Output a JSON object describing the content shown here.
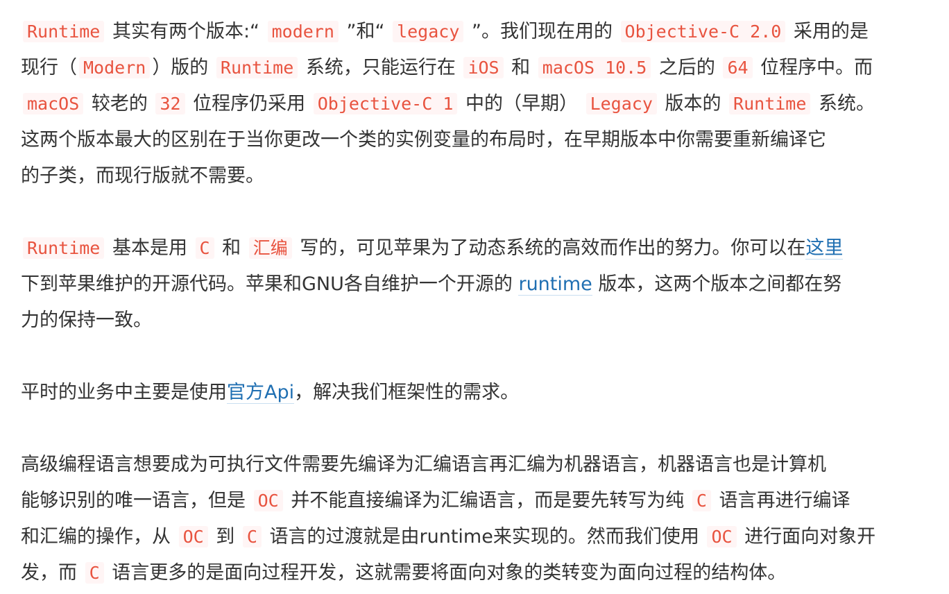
{
  "paragraphs": [
    {
      "lines": [
        [
          {
            "type": "code",
            "text": "Runtime"
          },
          {
            "type": "text",
            "text": " 其实有两个版本:“ "
          },
          {
            "type": "code",
            "text": "modern"
          },
          {
            "type": "text",
            "text": " ”和“ "
          },
          {
            "type": "code",
            "text": "legacy"
          },
          {
            "type": "text",
            "text": " ”。我们现在用的 "
          },
          {
            "type": "code",
            "text": "Objective-C 2.0"
          },
          {
            "type": "text",
            "text": " 采用的是"
          }
        ],
        [
          {
            "type": "text",
            "text": "现行（"
          },
          {
            "type": "code",
            "text": "Modern"
          },
          {
            "type": "text",
            "text": "）版的 "
          },
          {
            "type": "code",
            "text": "Runtime"
          },
          {
            "type": "text",
            "text": " 系统，只能运行在 "
          },
          {
            "type": "code",
            "text": "iOS"
          },
          {
            "type": "text",
            "text": " 和 "
          },
          {
            "type": "code",
            "text": "macOS 10.5"
          },
          {
            "type": "text",
            "text": " 之后的 "
          },
          {
            "type": "code",
            "text": "64"
          },
          {
            "type": "text",
            "text": " 位程序中。而"
          }
        ],
        [
          {
            "type": "code",
            "text": "macOS"
          },
          {
            "type": "text",
            "text": " 较老的 "
          },
          {
            "type": "code",
            "text": "32"
          },
          {
            "type": "text",
            "text": " 位程序仍采用 "
          },
          {
            "type": "code",
            "text": "Objective-C 1"
          },
          {
            "type": "text",
            "text": " 中的（早期） "
          },
          {
            "type": "code",
            "text": "Legacy"
          },
          {
            "type": "text",
            "text": " 版本的 "
          },
          {
            "type": "code",
            "text": "Runtime"
          },
          {
            "type": "text",
            "text": " 系统。"
          }
        ],
        [
          {
            "type": "text",
            "text": "这两个版本最大的区别在于当你更改一个类的实例变量的布局时，在早期版本中你需要重新编译它"
          }
        ],
        [
          {
            "type": "text",
            "text": "的子类，而现行版就不需要。"
          }
        ]
      ]
    },
    {
      "lines": [
        [
          {
            "type": "code",
            "text": "Runtime"
          },
          {
            "type": "text",
            "text": " 基本是用 "
          },
          {
            "type": "code",
            "text": "C"
          },
          {
            "type": "text",
            "text": " 和 "
          },
          {
            "type": "code",
            "text": "汇编"
          },
          {
            "type": "text",
            "text": " 写的，可见苹果为了动态系统的高效而作出的努力。你可以在"
          },
          {
            "type": "link",
            "text": "这里"
          }
        ],
        [
          {
            "type": "text",
            "text": "下到苹果维护的开源代码。苹果和GNU各自维护一个开源的 "
          },
          {
            "type": "link",
            "text": "runtime"
          },
          {
            "type": "text",
            "text": " 版本，这两个版本之间都在努"
          }
        ],
        [
          {
            "type": "text",
            "text": "力的保持一致。"
          }
        ]
      ]
    },
    {
      "lines": [
        [
          {
            "type": "text",
            "text": "平时的业务中主要是使用"
          },
          {
            "type": "link",
            "text": "官方Api"
          },
          {
            "type": "text",
            "text": "，解决我们框架性的需求。"
          }
        ]
      ]
    },
    {
      "lines": [
        [
          {
            "type": "text",
            "text": "高级编程语言想要成为可执行文件需要先编译为汇编语言再汇编为机器语言，机器语言也是计算机"
          }
        ],
        [
          {
            "type": "text",
            "text": "能够识别的唯一语言，但是 "
          },
          {
            "type": "code",
            "text": "OC"
          },
          {
            "type": "text",
            "text": " 并不能直接编译为汇编语言，而是要先转写为纯 "
          },
          {
            "type": "code",
            "text": "C"
          },
          {
            "type": "text",
            "text": " 语言再进行编译"
          }
        ],
        [
          {
            "type": "text",
            "text": "和汇编的操作，从 "
          },
          {
            "type": "code",
            "text": "OC"
          },
          {
            "type": "text",
            "text": " 到 "
          },
          {
            "type": "code",
            "text": "C"
          },
          {
            "type": "text",
            "text": " 语言的过渡就是由runtime来实现的。然而我们使用 "
          },
          {
            "type": "code",
            "text": "OC"
          },
          {
            "type": "text",
            "text": " 进行面向对象开"
          }
        ],
        [
          {
            "type": "text",
            "text": "发，而 "
          },
          {
            "type": "code",
            "text": "C"
          },
          {
            "type": "text",
            "text": " 语言更多的是面向过程开发，这就需要将面向对象的类转变为面向过程的结构体。"
          }
        ]
      ]
    }
  ]
}
